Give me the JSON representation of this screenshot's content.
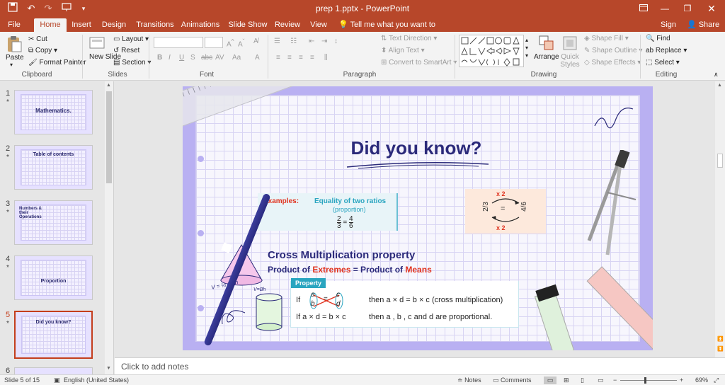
{
  "window": {
    "doc_title": "prep 1.pptx - PowerPoint",
    "help_label": "?"
  },
  "tabs": [
    {
      "label": "File"
    },
    {
      "label": "Home"
    },
    {
      "label": "Insert"
    },
    {
      "label": "Design"
    },
    {
      "label": "Transitions"
    },
    {
      "label": "Animations"
    },
    {
      "label": "Slide Show"
    },
    {
      "label": "Review"
    },
    {
      "label": "View"
    }
  ],
  "tell_me": "Tell me what you want to do...",
  "account": {
    "sign_in": "Sign in",
    "share": "Share"
  },
  "ribbon": {
    "clipboard": {
      "paste": "Paste",
      "cut": "Cut",
      "copy": "Copy",
      "format_painter": "Format Painter",
      "label": "Clipboard"
    },
    "slides": {
      "new_slide": "New Slide",
      "layout": "Layout",
      "reset": "Reset",
      "section": "Section",
      "label": "Slides"
    },
    "font": {
      "label": "Font"
    },
    "paragraph": {
      "text_direction": "Text Direction",
      "align_text": "Align Text",
      "convert_smartart": "Convert to SmartArt",
      "label": "Paragraph"
    },
    "drawing": {
      "arrange": "Arrange",
      "quick_styles": "Quick Styles",
      "shape_fill": "Shape Fill",
      "shape_outline": "Shape Outline",
      "shape_effects": "Shape Effects",
      "label": "Drawing"
    },
    "editing": {
      "find": "Find",
      "replace": "Replace",
      "select": "Select",
      "label": "Editing"
    }
  },
  "thumbnails": [
    {
      "num": "1",
      "star": "*",
      "title": "Mathematics."
    },
    {
      "num": "2",
      "star": "*",
      "title": "Table of contents"
    },
    {
      "num": "3",
      "star": "*",
      "title": "Numbers & their Operations"
    },
    {
      "num": "4",
      "star": "*",
      "title": "Proportion"
    },
    {
      "num": "5",
      "star": "*",
      "title": "Did you know?"
    },
    {
      "num": "6",
      "star": "",
      "title": ""
    }
  ],
  "slide": {
    "title": "Did you know?",
    "examples_label": "Examples:",
    "equality_title": "Equality of two ratios",
    "equality_sub": "(proportion)",
    "frac": {
      "a": "2",
      "b": "3",
      "c": "4",
      "d": "6"
    },
    "cross_label": "x 2",
    "cross_frac": {
      "a": "2",
      "b": "3",
      "c": "4",
      "d": "6"
    },
    "cm_title": "Cross Multiplication property",
    "cm_sub_1": "Product of ",
    "cm_sub_extremes": "Extremes",
    "cm_sub_2": " = Product of ",
    "cm_sub_means": "Means",
    "property_tab": "Property",
    "if_1": "If",
    "then_1": "then a × d = b × c  (cross multiplication)",
    "if_2": "If  a × d = b × c",
    "then_2": "then a , b , c and d are proportional.",
    "cone_formula": "V = ⅓ πr²h",
    "cyl_formula": "V=Bh"
  },
  "notes_placeholder": "Click to add notes",
  "status": {
    "slide_info": "Slide 5 of 15",
    "language": "English (United States)",
    "notes": "Notes",
    "comments": "Comments",
    "zoom": "69%"
  },
  "colors": {
    "accent": "#b7472a",
    "slide_bg": "#b9b0f2",
    "title": "#2b2a7a",
    "red": "#e0331f",
    "teal": "#2aa5c0"
  }
}
